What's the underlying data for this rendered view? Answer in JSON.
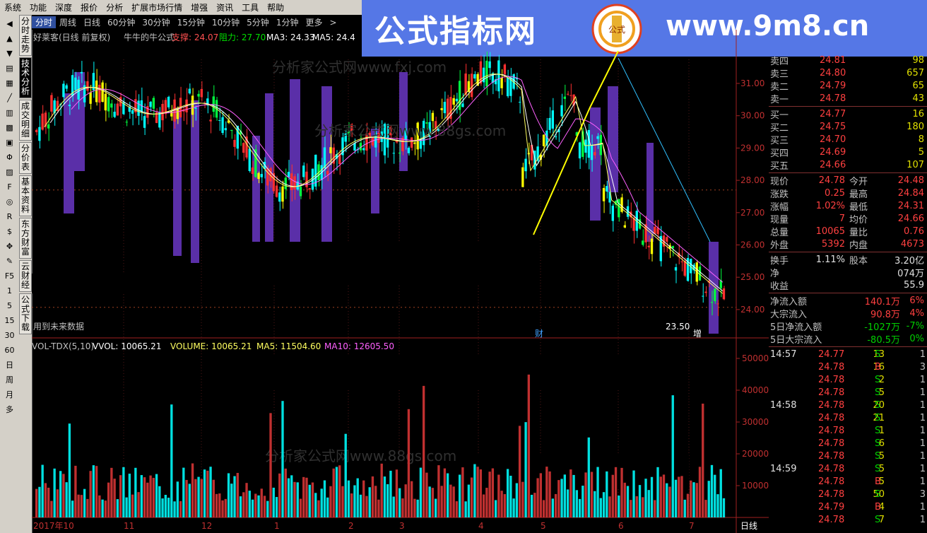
{
  "menu": [
    "系统",
    "功能",
    "深度",
    "报价",
    "分析",
    "扩展市场行情",
    "增强",
    "资讯",
    "工具",
    "帮助"
  ],
  "banner": {
    "title": "公式指标网",
    "url": "www.9m8.cn",
    "logo_sub": "公式"
  },
  "side_tabs": [
    {
      "label": "分时走势",
      "active": false
    },
    {
      "label": "技术分析",
      "active": true
    },
    {
      "label": "成交明细",
      "active": false
    },
    {
      "label": "分价表",
      "active": false
    },
    {
      "label": "基本资料",
      "active": false
    },
    {
      "label": "东方财富",
      "active": false
    },
    {
      "label": "云财经",
      "active": false
    },
    {
      "label": "公式下载",
      "active": false
    }
  ],
  "left_toolbar": [
    "F5",
    "1",
    "5",
    "15",
    "30",
    "60",
    "日",
    "周",
    "月",
    "多"
  ],
  "periods": [
    "分时",
    "周线",
    "日线",
    "60分钟",
    "30分钟",
    "15分钟",
    "10分钟",
    "5分钟",
    "1分钟",
    "更多",
    ">"
  ],
  "main_header": {
    "stock": "好莱客(日线 前复权)",
    "formula": "牛牛的牛公式",
    "support_label": "支撑: 24.07",
    "resist_label": "阻力: 27.70",
    "ma3_label": "MA3: 24.33",
    "ma5_label": "MA5: 24.4"
  },
  "price_axis": [
    "31.00",
    "30.00",
    "29.00",
    "28.00",
    "27.00",
    "26.00",
    "25.00",
    "24.00"
  ],
  "price_annot": {
    "low": "23.50",
    "future": "用到未来数据",
    "cai": "财",
    "zeng": "增"
  },
  "vol_header": {
    "name": "VOL-TDX(5,10)",
    "vvol": "VVOL: 10065.21",
    "volume": "VOLUME: 10065.21",
    "ma5": "MA5: 11504.60",
    "ma10": "MA10: 12605.50"
  },
  "vol_axis": [
    "50000",
    "40000",
    "30000",
    "20000",
    "10000"
  ],
  "date_axis": [
    "2017年10",
    "11",
    "12",
    "1",
    "2",
    "3",
    "4",
    "5",
    "6",
    "7"
  ],
  "period_label": "日线",
  "watermarks": [
    "分析家公式网www.fxj.com",
    "分析家公式网www.88gs.com",
    "分析家公式网www.88gs.com"
  ],
  "order_book": {
    "asks": [
      {
        "label": "卖四",
        "price": "24.81",
        "vol": "98"
      },
      {
        "label": "卖三",
        "price": "24.80",
        "vol": "657"
      },
      {
        "label": "卖二",
        "price": "24.79",
        "vol": "65"
      },
      {
        "label": "卖一",
        "price": "24.78",
        "vol": "43"
      }
    ],
    "bids": [
      {
        "label": "买一",
        "price": "24.77",
        "vol": "16"
      },
      {
        "label": "买二",
        "price": "24.75",
        "vol": "180"
      },
      {
        "label": "买三",
        "price": "24.70",
        "vol": "8"
      },
      {
        "label": "买四",
        "price": "24.69",
        "vol": "5"
      },
      {
        "label": "买五",
        "price": "24.66",
        "vol": "107"
      }
    ]
  },
  "quote": [
    {
      "l1": "现价",
      "v1": "24.78",
      "l2": "今开",
      "v2": "24.48"
    },
    {
      "l1": "涨跌",
      "v1": "0.25",
      "l2": "最高",
      "v2": "24.84"
    },
    {
      "l1": "涨幅",
      "v1": "1.02%",
      "l2": "最低",
      "v2": "24.31"
    },
    {
      "l1": "现量",
      "v1": "7",
      "l2": "均价",
      "v2": "24.66"
    },
    {
      "l1": "总量",
      "v1": "10065",
      "l2": "量比",
      "v2": "0.76"
    },
    {
      "l1": "外盘",
      "v1": "5392",
      "l2": "内盘",
      "v2": "4673"
    }
  ],
  "quote2": [
    {
      "l1": "换手",
      "v1": "1.11%",
      "l2": "股本",
      "v2": "3.20亿"
    },
    {
      "l1": "净",
      "v1": "",
      "l2": "",
      "v2": "074万"
    },
    {
      "l1": "收益",
      "v1": "",
      "l2": "",
      "v2": "55.9"
    }
  ],
  "flows": [
    {
      "label": "净流入额",
      "value": "140.1万",
      "pct": "6%"
    },
    {
      "label": "大宗流入",
      "value": "90.8万",
      "pct": "4%"
    },
    {
      "label": "5日净流入额",
      "value": "-1027万",
      "pct": "-7%"
    },
    {
      "label": "5日大宗流入",
      "value": "-80.5万",
      "pct": "0%"
    }
  ],
  "ticks": [
    {
      "time": "14:57",
      "price": "24.77",
      "vol": "13",
      "side": "S",
      "n": "1"
    },
    {
      "time": "",
      "price": "24.78",
      "vol": "16",
      "side": "B",
      "n": "3"
    },
    {
      "time": "",
      "price": "24.78",
      "vol": "2",
      "side": "S",
      "n": "1"
    },
    {
      "time": "",
      "price": "24.78",
      "vol": "5",
      "side": "S",
      "n": "1"
    },
    {
      "time": "14:58",
      "price": "24.78",
      "vol": "20",
      "side": "S",
      "n": "1"
    },
    {
      "time": "",
      "price": "24.78",
      "vol": "21",
      "side": "S",
      "n": "1"
    },
    {
      "time": "",
      "price": "24.78",
      "vol": "1",
      "side": "S",
      "n": "1"
    },
    {
      "time": "",
      "price": "24.78",
      "vol": "6",
      "side": "S",
      "n": "1"
    },
    {
      "time": "",
      "price": "24.78",
      "vol": "5",
      "side": "S",
      "n": "1"
    },
    {
      "time": "14:59",
      "price": "24.78",
      "vol": "5",
      "side": "S",
      "n": "1"
    },
    {
      "time": "",
      "price": "24.78",
      "vol": "5",
      "side": "B",
      "n": "1"
    },
    {
      "time": "",
      "price": "24.78",
      "vol": "50",
      "side": "S",
      "n": "3"
    },
    {
      "time": "",
      "price": "24.79",
      "vol": "4",
      "side": "B",
      "n": "1"
    },
    {
      "time": "",
      "price": "24.78",
      "vol": "7",
      "side": "S",
      "n": "1"
    }
  ],
  "colors": {
    "up": "#ff3030",
    "down": "#00ffff",
    "ma5": "#ffffff",
    "ma10": "#ff60ff",
    "purple": "#5a2fa8",
    "yellow": "#ffff00",
    "green": "#00ff40"
  }
}
